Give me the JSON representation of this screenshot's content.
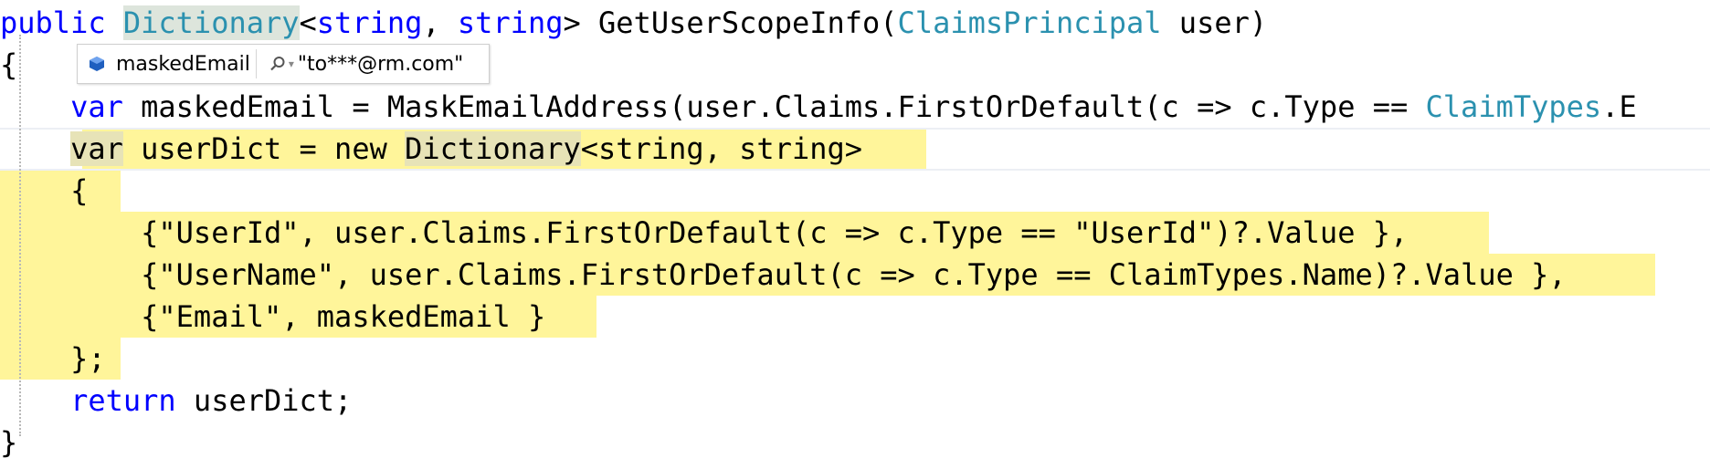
{
  "code": {
    "line1": {
      "kw": "public",
      "sp1": " ",
      "type_hl": "Dictionary",
      "generic_open": "<",
      "kw2": "string",
      "comma": ", ",
      "kw3": "string",
      "rest": "> GetUserScopeInfo(",
      "param_type": "ClaimsPrincipal",
      "param_rest": " user)"
    },
    "line2": {
      "brace": "{"
    },
    "line3": {
      "indent": "    ",
      "kw": "var",
      "text": " maskedEmail = MaskEmailAddress(user.Claims.FirstOrDefault(c => c.Type == ",
      "type": "ClaimTypes",
      "tail": ".E"
    },
    "line4": {
      "indent": "    ",
      "kw": "var",
      "text": " userDict = new ",
      "type": "Dictionary",
      "generic": "<string, string>"
    },
    "line5": {
      "text": "    {"
    },
    "line6": {
      "text": "        {\"UserId\", user.Claims.FirstOrDefault(c => c.Type == \"UserId\")?.Value },"
    },
    "line7": {
      "text": "        {\"UserName\", user.Claims.FirstOrDefault(c => c.Type == ClaimTypes.Name)?.Value },"
    },
    "line8": {
      "text": "        {\"Email\", maskedEmail }"
    },
    "line9": {
      "text": "    };"
    },
    "line10": {
      "indent": "    ",
      "kw": "return",
      "text": " userDict;"
    },
    "line11": {
      "brace": "}"
    }
  },
  "datatip": {
    "variable_name": "maskedEmail",
    "value": "\"to***@rm.com\"",
    "icon": "field-cube-icon",
    "search_icon": "magnifier-icon"
  },
  "colors": {
    "keyword": "#0000ff",
    "type": "#2b91af",
    "highlight": "#fff59a",
    "plain": "#000000"
  }
}
